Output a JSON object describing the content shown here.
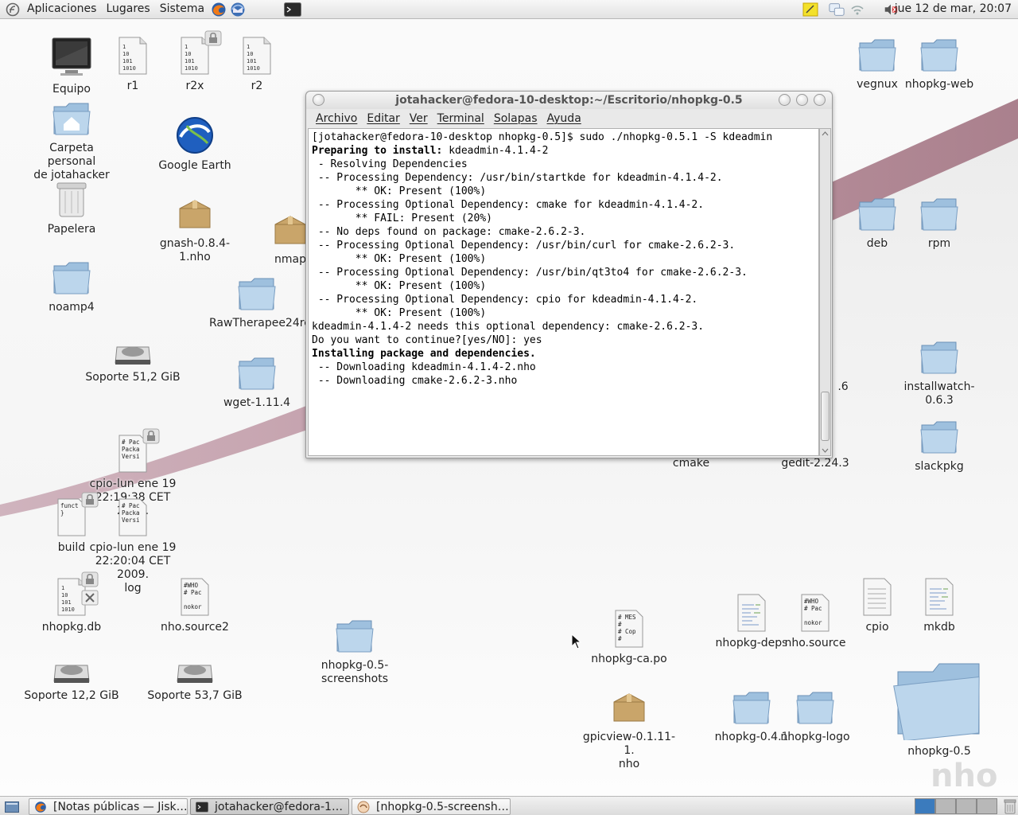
{
  "top_panel": {
    "menus": [
      "Aplicaciones",
      "Lugares",
      "Sistema"
    ],
    "clock": "jue 12 de mar, 20:07"
  },
  "terminal": {
    "title": "jotahacker@fedora-10-desktop:~/Escritorio/nhopkg-0.5",
    "menus": [
      "Archivo",
      "Editar",
      "Ver",
      "Terminal",
      "Solapas",
      "Ayuda"
    ],
    "lines": [
      {
        "text": "[jotahacker@fedora-10-desktop nhopkg-0.5]$ sudo ./nhopkg-0.5.1 -S kdeadmin",
        "bold": false
      },
      {
        "text": "Preparing to install:",
        "bold": true,
        "rest": " kdeadmin-4.1.4-2"
      },
      {
        "text": " - Resolving Dependencies",
        "bold": false
      },
      {
        "text": " -- Processing Dependency: /usr/bin/startkde for kdeadmin-4.1.4-2.",
        "bold": false
      },
      {
        "text": "       ** OK: Present (100%)",
        "bold": false
      },
      {
        "text": " -- Processing Optional Dependency: cmake for kdeadmin-4.1.4-2.",
        "bold": false
      },
      {
        "text": "       ** FAIL: Present (20%)",
        "bold": false
      },
      {
        "text": " -- No deps found on package: cmake-2.6.2-3.",
        "bold": false
      },
      {
        "text": " -- Processing Optional Dependency: /usr/bin/curl for cmake-2.6.2-3.",
        "bold": false
      },
      {
        "text": "       ** OK: Present (100%)",
        "bold": false
      },
      {
        "text": " -- Processing Optional Dependency: /usr/bin/qt3to4 for cmake-2.6.2-3.",
        "bold": false
      },
      {
        "text": "       ** OK: Present (100%)",
        "bold": false
      },
      {
        "text": " -- Processing Optional Dependency: cpio for kdeadmin-4.1.4-2.",
        "bold": false
      },
      {
        "text": "       ** OK: Present (100%)",
        "bold": false
      },
      {
        "text": "kdeadmin-4.1.4-2 needs this optional dependency: cmake-2.6.2-3.",
        "bold": false
      },
      {
        "text": "Do you want to continue?[yes/NO]: yes",
        "bold": false
      },
      {
        "text": "Installing package and dependencies.",
        "bold": true
      },
      {
        "text": " -- Downloading kdeadmin-4.1.4-2.nho",
        "bold": false
      },
      {
        "text": " -- Downloading cmake-2.6.2-3.nho",
        "bold": false
      }
    ]
  },
  "desktop_icons": [
    {
      "id": "equipo",
      "label": "Equipo",
      "kind": "computer"
    },
    {
      "id": "r1",
      "label": "r1",
      "kind": "binfile"
    },
    {
      "id": "r2x",
      "label": "r2x",
      "kind": "binfile",
      "badge": "lock"
    },
    {
      "id": "r2",
      "label": "r2",
      "kind": "binfile"
    },
    {
      "id": "vegnux",
      "label": "vegnux",
      "kind": "folder"
    },
    {
      "id": "nhopkg-web",
      "label": "nhopkg-web",
      "kind": "folder"
    },
    {
      "id": "home",
      "label": "Carpeta personal\nde jotahacker",
      "kind": "home"
    },
    {
      "id": "google-earth",
      "label": "Google Earth",
      "kind": "earth"
    },
    {
      "id": "papelera",
      "label": "Papelera",
      "kind": "trash"
    },
    {
      "id": "gnash",
      "label": "gnash-0.8.4-1.nho",
      "kind": "package"
    },
    {
      "id": "nmap",
      "label": "nmap",
      "kind": "package"
    },
    {
      "id": "deb",
      "label": "deb",
      "kind": "folder"
    },
    {
      "id": "rpm",
      "label": "rpm",
      "kind": "folder"
    },
    {
      "id": "noamp4",
      "label": "noamp4",
      "kind": "folder"
    },
    {
      "id": "rawtherapee",
      "label": "RawTherapee24rc",
      "kind": "folder"
    },
    {
      "id": "soporte51",
      "label": "Soporte 51,2 GiB",
      "kind": "drive"
    },
    {
      "id": "wget",
      "label": "wget-1.11.4",
      "kind": "folder"
    },
    {
      "id": "hidden6",
      "label": ".6",
      "kind": "none"
    },
    {
      "id": "installwatch",
      "label": "installwatch-0.6.3",
      "kind": "folder"
    },
    {
      "id": "cmake",
      "label": "cmake",
      "kind": "none"
    },
    {
      "id": "gedit",
      "label": "gedit-2.24.3",
      "kind": "none"
    },
    {
      "id": "slackpkg",
      "label": "slackpkg",
      "kind": "folder"
    },
    {
      "id": "cpio-lun1",
      "label": "cpio-lun ene 19\n22:19:38 CET 2009.",
      "kind": "textfile",
      "preview": "# Pac\nPacka\nVersi",
      "badge": "lock"
    },
    {
      "id": "build",
      "label": "build",
      "kind": "textfile",
      "preview": "funct\n}",
      "badge": "lock"
    },
    {
      "id": "cpio-lun2",
      "label": "cpio-lun ene 19\n22:20:04 CET 2009.\nlog",
      "kind": "textfile",
      "preview": "# Pac\nPacka\nVersi"
    },
    {
      "id": "nhopkgdb",
      "label": "nhopkg.db",
      "kind": "binfile",
      "badge": "lock-x"
    },
    {
      "id": "nhosource2",
      "label": "nho.source2",
      "kind": "textfile",
      "preview": "#WHO\n# Pac\n\nnokor"
    },
    {
      "id": "nhopkg-deps",
      "label": "nhopkg-deps",
      "kind": "doclines"
    },
    {
      "id": "nhosource",
      "label": "nho.source",
      "kind": "textfile",
      "preview": "#WHO\n# Pac\n\nnokor"
    },
    {
      "id": "cpio",
      "label": "cpio",
      "kind": "doc"
    },
    {
      "id": "mkdb",
      "label": "mkdb",
      "kind": "doclines"
    },
    {
      "id": "screenshots",
      "label": "nhopkg-0.5-\nscreenshots",
      "kind": "folder"
    },
    {
      "id": "nhopkg-ca",
      "label": "nhopkg-ca.po",
      "kind": "textfile",
      "preview": "# MES\n#\n# Cop\n#"
    },
    {
      "id": "soporte12",
      "label": "Soporte 12,2 GiB",
      "kind": "drive"
    },
    {
      "id": "soporte53",
      "label": "Soporte 53,7 GiB",
      "kind": "drive"
    },
    {
      "id": "gpicview",
      "label": "gpicview-0.1.11-1.\nnho",
      "kind": "package"
    },
    {
      "id": "nhopkg-041",
      "label": "nhopkg-0.4.1",
      "kind": "folder"
    },
    {
      "id": "nhopkg-logo",
      "label": "nhopkg-logo",
      "kind": "folder"
    },
    {
      "id": "nhopkg-05",
      "label": "nhopkg-0.5",
      "kind": "bigfolder"
    }
  ],
  "taskbar": {
    "tasks": [
      {
        "label": "[Notas públicas — Jisk…",
        "icon": "firefox-icon"
      },
      {
        "label": "jotahacker@fedora-1…",
        "icon": "terminal-icon",
        "active": true
      },
      {
        "label": "[nhopkg-0.5-screensh…",
        "icon": "file-manager-icon"
      }
    ]
  },
  "watermark": "nho"
}
